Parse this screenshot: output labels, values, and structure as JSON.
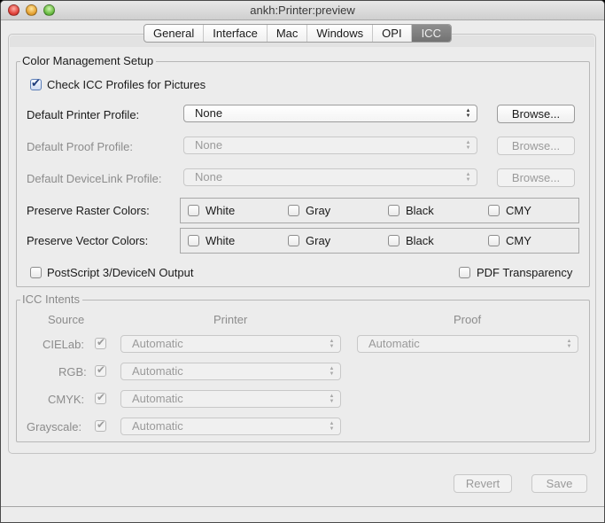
{
  "window": {
    "title": "ankh:Printer:preview"
  },
  "tabs": [
    {
      "label": "General",
      "active": false
    },
    {
      "label": "Interface",
      "active": false
    },
    {
      "label": "Mac",
      "active": false
    },
    {
      "label": "Windows",
      "active": false
    },
    {
      "label": "OPI",
      "active": false
    },
    {
      "label": "ICC",
      "active": true
    }
  ],
  "color_management": {
    "title": "Color Management Setup",
    "check_icc": {
      "label": "Check ICC Profiles for Pictures",
      "checked": true
    },
    "printer_profile": {
      "label": "Default Printer Profile:",
      "value": "None",
      "browse": "Browse...",
      "enabled": true
    },
    "proof_profile": {
      "label": "Default Proof Profile:",
      "value": "None",
      "browse": "Browse...",
      "enabled": false
    },
    "devicelink_profile": {
      "label": "Default DeviceLink Profile:",
      "value": "None",
      "browse": "Browse...",
      "enabled": false
    },
    "raster": {
      "label": "Preserve Raster Colors:",
      "options": [
        {
          "label": "White",
          "checked": false
        },
        {
          "label": "Gray",
          "checked": false
        },
        {
          "label": "Black",
          "checked": false
        },
        {
          "label": "CMY",
          "checked": false
        }
      ]
    },
    "vector": {
      "label": "Preserve Vector Colors:",
      "options": [
        {
          "label": "White",
          "checked": false
        },
        {
          "label": "Gray",
          "checked": false
        },
        {
          "label": "Black",
          "checked": false
        },
        {
          "label": "CMY",
          "checked": false
        }
      ]
    },
    "postscript": {
      "label": "PostScript 3/DeviceN Output",
      "checked": false
    },
    "pdf_transparency": {
      "label": "PDF Transparency",
      "checked": false
    }
  },
  "icc_intents": {
    "title": "ICC Intents",
    "headers": {
      "source": "Source",
      "printer": "Printer",
      "proof": "Proof"
    },
    "rows": [
      {
        "source": "CIELab:",
        "checked": true,
        "printer": "Automatic",
        "proof": "Automatic"
      },
      {
        "source": "RGB:",
        "checked": true,
        "printer": "Automatic"
      },
      {
        "source": "CMYK:",
        "checked": true,
        "printer": "Automatic"
      },
      {
        "source": "Grayscale:",
        "checked": true,
        "printer": "Automatic"
      }
    ]
  },
  "buttons": {
    "revert": "Revert",
    "save": "Save"
  }
}
